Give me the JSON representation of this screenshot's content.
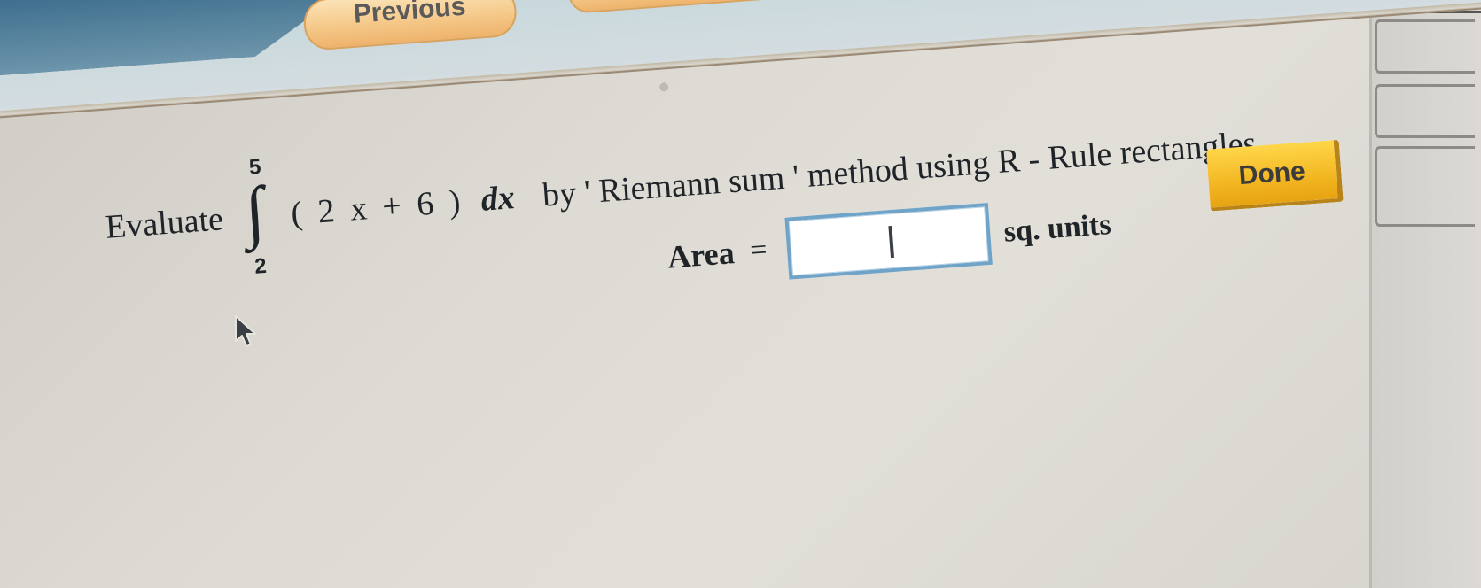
{
  "nav": {
    "previous_label": "Previous",
    "next_label": ""
  },
  "question": {
    "evaluate_word": "Evaluate",
    "integral": {
      "upper_limit": "5",
      "lower_limit": "2",
      "sign": "∫"
    },
    "expression": "( 2 x + 6 )",
    "differential": "dx",
    "method_text": "by ' Riemann sum ' method using R - Rule rectangles."
  },
  "answer": {
    "label": "Area",
    "equals": "=",
    "value": "",
    "units": "sq. units"
  },
  "actions": {
    "done_label": "Done"
  },
  "colors": {
    "button_orange": "#f5c98a",
    "done_yellow": "#f2b722",
    "input_border": "#6fa3c7",
    "header_blue": "#3e6f8e"
  }
}
